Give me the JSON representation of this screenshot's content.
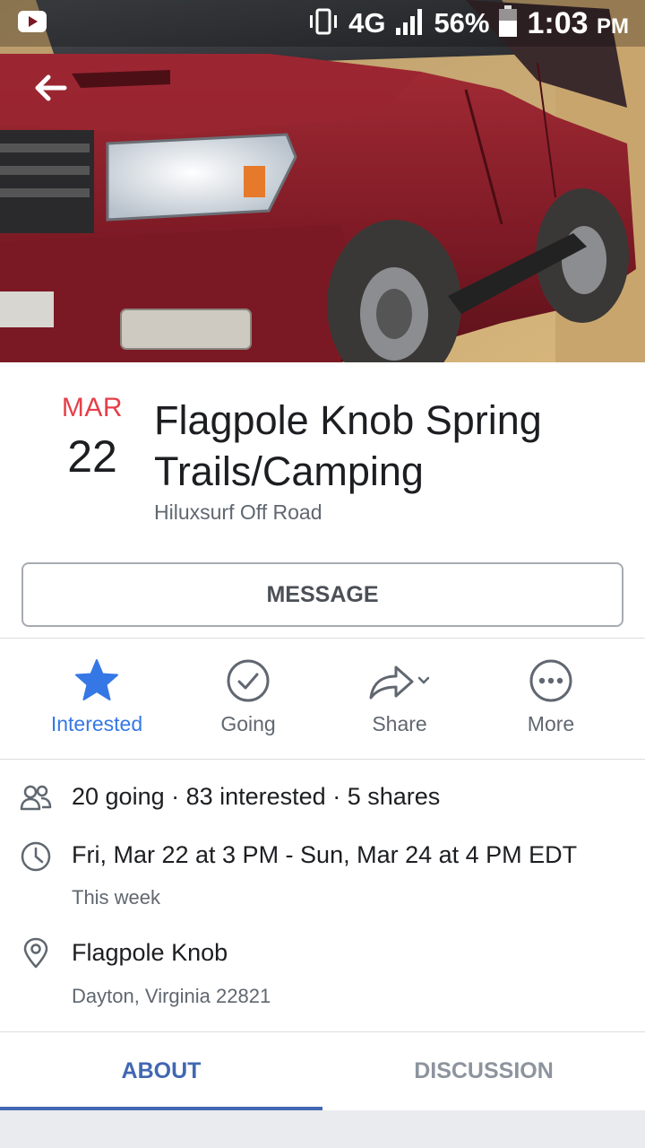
{
  "status_bar": {
    "network": "4G",
    "battery": "56%",
    "time": "1:03",
    "ampm": "PM"
  },
  "icons": {
    "back": "back-arrow-icon",
    "interested": "star-icon",
    "going": "check-circle-icon",
    "share": "share-arrow-icon",
    "more": "more-dots-icon",
    "attendees": "people-icon",
    "time": "clock-icon",
    "location": "location-pin-icon"
  },
  "event": {
    "month": "MAR",
    "day": "22",
    "title": "Flagpole Knob Spring Trails/Camping",
    "host": "Hiluxsurf Off Road"
  },
  "message_button": "MESSAGE",
  "actions": [
    {
      "label": "Interested",
      "active": true
    },
    {
      "label": "Going",
      "active": false
    },
    {
      "label": "Share",
      "active": false
    },
    {
      "label": "More",
      "active": false
    }
  ],
  "info": {
    "attendance": "20 going · 83 interested · 5 shares",
    "datetime": "Fri, Mar 22 at 3 PM - Sun, Mar 24 at 4 PM EDT",
    "relative_time": "This week",
    "location_name": "Flagpole Knob",
    "location_address": "Dayton, Virginia 22821"
  },
  "tabs": [
    {
      "label": "ABOUT",
      "active": true
    },
    {
      "label": "DISCUSSION",
      "active": false
    }
  ],
  "colors": {
    "accent": "#3578e5",
    "tab_active": "#4267b2",
    "date_month": "#e4404a",
    "secondary_text": "#606770"
  }
}
